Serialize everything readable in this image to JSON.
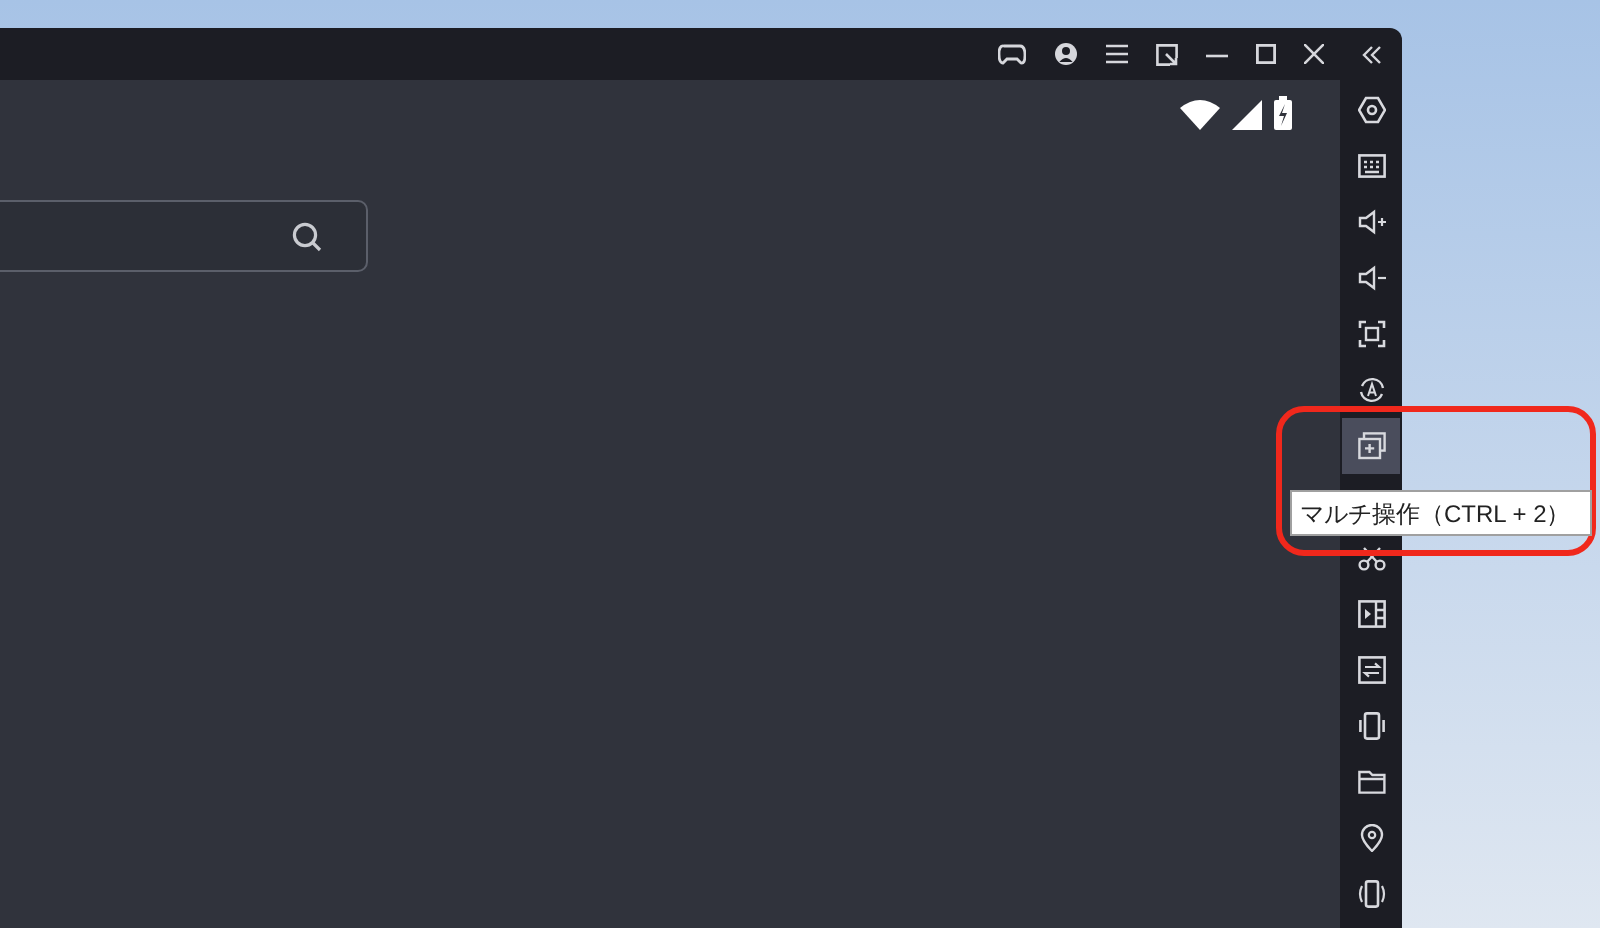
{
  "sidebar": {
    "items": [
      {
        "kind": "settings",
        "selected": false
      },
      {
        "kind": "keyboard",
        "selected": false
      },
      {
        "kind": "volume-up",
        "selected": false
      },
      {
        "kind": "volume-down",
        "selected": false
      },
      {
        "kind": "screenshot",
        "selected": false
      },
      {
        "kind": "rotate",
        "selected": false
      },
      {
        "kind": "multi-window",
        "selected": true
      },
      {
        "kind": "scissors",
        "selected": false
      },
      {
        "kind": "video",
        "selected": false
      },
      {
        "kind": "swap",
        "selected": false
      },
      {
        "kind": "shake",
        "selected": false
      },
      {
        "kind": "folder",
        "selected": false
      },
      {
        "kind": "location",
        "selected": false
      },
      {
        "kind": "vibrate",
        "selected": false
      }
    ]
  },
  "tooltip": {
    "text": "マルチ操作（CTRL + 2）"
  }
}
